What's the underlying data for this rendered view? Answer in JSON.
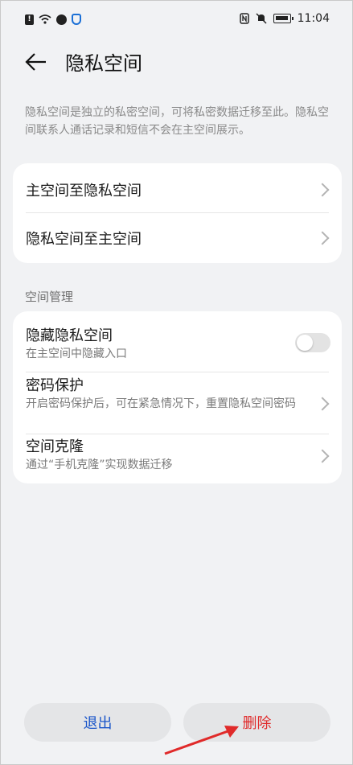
{
  "status": {
    "time": "11:04",
    "left_icons": [
      "alert-icon",
      "wifi-icon",
      "app-icon",
      "shield-icon"
    ],
    "right_icons": [
      "nfc-icon",
      "mute-icon",
      "battery-icon"
    ]
  },
  "header": {
    "title": "隐私空间",
    "back_icon": "back-arrow-icon"
  },
  "description": "隐私空间是独立的私密空间，可将私密数据迁移至此。隐私空间联系人通话记录和短信不会在主空间展示。",
  "transfer": {
    "items": [
      {
        "label": "主空间至隐私空间"
      },
      {
        "label": "隐私空间至主空间"
      }
    ]
  },
  "management": {
    "section_title": "空间管理",
    "hide": {
      "label": "隐藏隐私空间",
      "sub": "在主空间中隐藏入口",
      "enabled": false
    },
    "password": {
      "label": "密码保护",
      "sub": "开启密码保护后，可在紧急情况下，重置隐私空间密码"
    },
    "clone": {
      "label": "空间克隆",
      "sub": "通过“手机克隆”实现数据迁移"
    }
  },
  "buttons": {
    "exit": "退出",
    "delete": "删除"
  },
  "colors": {
    "accent": "#1a55c9",
    "danger": "#e02a2a",
    "annotation_arrow": "#e02a2a"
  }
}
